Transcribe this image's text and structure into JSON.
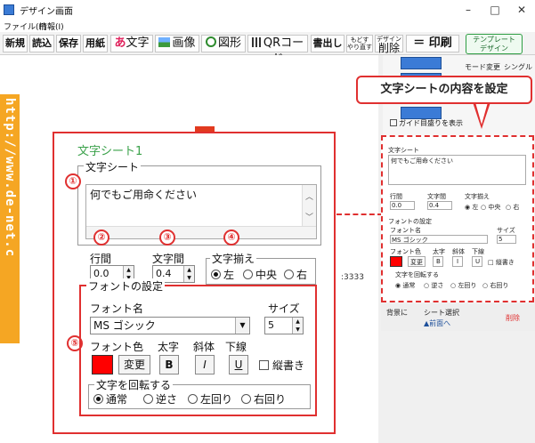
{
  "window": {
    "title": "デザイン画面",
    "menu": [
      "ファイル(F)",
      "情報(I)"
    ],
    "controls": [
      "–",
      "□",
      "✕"
    ]
  },
  "toolbar": {
    "new": "新規",
    "open": "読込",
    "save": "保存",
    "paper": "用紙",
    "text": "文字",
    "image": "画像",
    "shape": "図形",
    "qr": "QRコード",
    "write": "書出し",
    "undo_line1": "もどす",
    "undo_line2": "やり直す",
    "design_del_line1": "デザイン",
    "design_del_line2": "削除",
    "print": "印刷",
    "template_line1": "テンプレート",
    "template_line2": "デザイン"
  },
  "canvas": {
    "url_text": "http://www.de-net.c",
    "number_text": ":3333"
  },
  "side": {
    "mode_change": "モード変更",
    "single": "シングル",
    "guide_checkbox": "ガイド目盛りを表示",
    "callout": "文字シートの内容を設定",
    "bottom_label1": "背景に",
    "bottom_label2": "シート選択",
    "bottom_prev": "▲前面へ",
    "bottom_delete": "削除"
  },
  "mini": {
    "sheet": "文字シート",
    "text_value": "何でもご用命ください",
    "line": "行間",
    "char": "文字間",
    "align": "文字揃え",
    "line_val": "0.0",
    "char_val": "0.4",
    "align_left": "左",
    "align_center": "中央",
    "align_right": "右",
    "font_settings": "フォントの設定",
    "font_name": "フォント名",
    "size": "サイズ",
    "font_val": "MS ゴシック",
    "size_val": "5",
    "font_color": "フォント色",
    "bold": "太字",
    "italic": "斜体",
    "underline": "下線",
    "change": "変更",
    "b": "B",
    "i": "I",
    "u": "U",
    "vertical": "縦書き",
    "rotate": "文字を回転する",
    "r_normal": "通常",
    "r_reverse": "逆さ",
    "r_left": "左回り",
    "r_right": "右回り"
  },
  "panel": {
    "title": "文字シート1",
    "sheet_label": "文字シート",
    "text_value": "何でもご用命ください",
    "line_spacing_label": "行間",
    "line_spacing_value": "0.0",
    "char_spacing_label": "文字間",
    "char_spacing_value": "0.4",
    "align_label": "文字揃え",
    "align_left": "左",
    "align_center": "中央",
    "align_right": "右",
    "font_settings_label": "フォントの設定",
    "font_name_label": "フォント名",
    "font_name_value": "MS ゴシック",
    "size_label": "サイズ",
    "size_value": "5",
    "font_color_label": "フォント色",
    "bold_label": "太字",
    "italic_label": "斜体",
    "underline_label": "下線",
    "change_button": "変更",
    "bold_button": "B",
    "italic_button": "I",
    "underline_button": "U",
    "vertical_label": "縦書き",
    "rotate_label": "文字を回転する",
    "rotate_normal": "通常",
    "rotate_reverse": "逆さ",
    "rotate_left": "左回り",
    "rotate_right": "右回り"
  },
  "markers": [
    "①",
    "②",
    "③",
    "④",
    "⑤"
  ],
  "colors": {
    "accent_red": "#e03030",
    "font_color": "#ff0000",
    "title_green": "#3aa14a",
    "url_strip": "#f5a623"
  }
}
